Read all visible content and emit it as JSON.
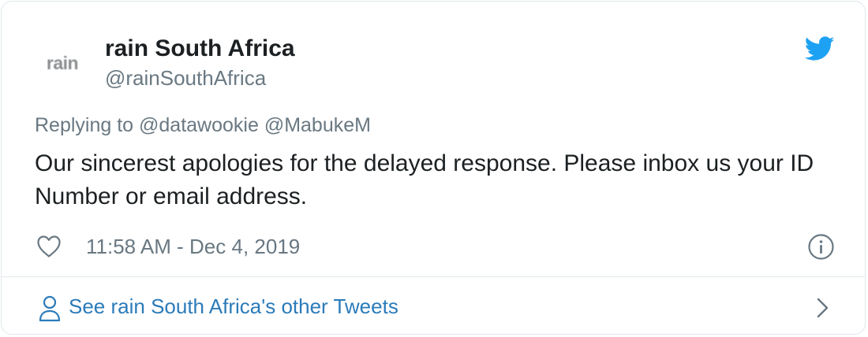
{
  "author": {
    "avatar_text": "rain",
    "display_name": "rain South Africa",
    "handle": "@rainSouthAfrica"
  },
  "tweet": {
    "reply_context": "Replying to @datawookie @MabukeM",
    "text": "Our sincerest apologies for the delayed response. Please inbox us your ID Number or email address.",
    "timestamp": "11:58 AM - Dec 4, 2019"
  },
  "footer": {
    "link_label": "See rain South Africa's other Tweets"
  },
  "icons": {
    "brand": "twitter-bird-icon",
    "like": "heart-icon",
    "info": "info-icon",
    "profile": "person-icon",
    "next": "chevron-right-icon"
  },
  "colors": {
    "twitter_blue": "#1da1f2",
    "link_blue": "#2b7bb9",
    "secondary_text": "#697882",
    "primary_text": "#1c2022",
    "border": "#e1e8ed"
  }
}
